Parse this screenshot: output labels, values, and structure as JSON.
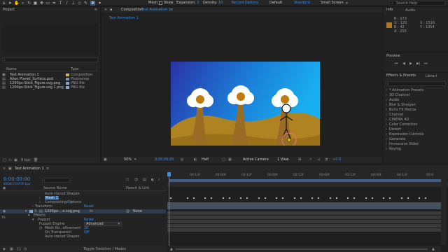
{
  "toolbar": {
    "mesh_label": "Mesh:",
    "show_label": "Show",
    "expansion_label": "Expansion:",
    "expansion_value": "3",
    "density_label": "Density:",
    "density_value": "10",
    "record_label": "Record Options",
    "workspaces": [
      "Default",
      "Standard",
      "Small Screen"
    ],
    "active_workspace": "Standard",
    "search_help": "Search Help"
  },
  "project": {
    "title": "Project",
    "columns": {
      "name": "Name",
      "type": "Type"
    },
    "items": [
      {
        "name": "Test Animation 1",
        "type": "Composition",
        "color": "#c9b35c"
      },
      {
        "name": "Alien Planet_Surface.psd",
        "type": "Photoshop",
        "color": "#7a8fb8"
      },
      {
        "name": "1200px-Stick_Figure.svg.png",
        "type": "PNG file",
        "color": "#8aa3c4"
      },
      {
        "name": "1200px-Stick_Figure.svg 1.png",
        "type": "PNG file",
        "color": "#8aa3c4"
      }
    ],
    "bpc": "8 bpc"
  },
  "composition": {
    "tab_prefix": "Composition",
    "tab_name": "Test Animation 1",
    "subtab": "Test Animation 1",
    "footer": {
      "zoom": "50%",
      "time": "0;00;00;00",
      "resolution": "Half",
      "camera": "Active Camera",
      "views": "1 View",
      "exposure": "+0.0"
    }
  },
  "info": {
    "tab": "Info",
    "audio_tab": "Audio",
    "r": "R : 173",
    "g": "G : 120",
    "b": "B : 42",
    "a": "A : 255",
    "x": "X : 1516",
    "y": "Y : 1054",
    "sample_color": "#ad782a"
  },
  "preview": {
    "title": "Preview"
  },
  "effects": {
    "title": "Effects & Presets",
    "libraries_tab": "Librari",
    "items": [
      "* Animation Presets",
      "3D Channel",
      "Audio",
      "Blur & Sharpen",
      "Boris FX Mocha",
      "Channel",
      "CINEMA 4D",
      "Color Correction",
      "Distort",
      "Expression Controls",
      "Generate",
      "Immersive Video",
      "Keying"
    ]
  },
  "timeline": {
    "tab": "Test Animation 1",
    "timecode": "0:00:00:00",
    "frames": "00000 (23.976 fps)",
    "ruler": [
      "00:12f",
      "01:00f",
      "01:12f",
      "02:00f",
      "02:12f",
      "03:00f",
      "03:12f",
      "04:00f",
      "04:12f",
      "05:0"
    ],
    "col_source": "Source Name",
    "col_parent": "Parent & Link",
    "rows": {
      "auto_traced": "Auto-traced Shapes",
      "mesh": "Mesh 1",
      "compositing": "Compositing Options",
      "transform": "Transform",
      "reset": "Reset",
      "layer_num": "3",
      "layer_name": "1200px-...e.svg.png",
      "parent": "None",
      "effects": "Effects",
      "puppet": "Puppet",
      "puppet_engine": "Puppet Engine",
      "engine_value": "Advanced",
      "mesh_refinement": "Mesh Ro...efinement",
      "refinement_value": "20",
      "on_transparent": "On Transparent",
      "on_transparent_value": "Off",
      "auto_traced_2": "Auto-traced Shapes"
    },
    "toggle": "Toggle Switches / Modes"
  }
}
